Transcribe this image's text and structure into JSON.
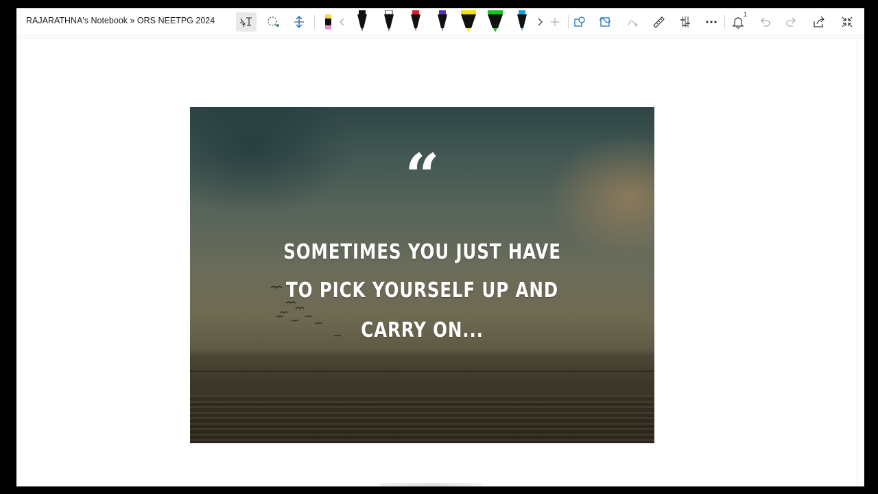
{
  "window": {
    "breadcrumb": "RAJARATHNA's Notebook » ORS NEETPG 2024"
  },
  "toolbar": {
    "tools": [
      {
        "icon": "text-select-icon"
      },
      {
        "icon": "lasso-select-icon"
      },
      {
        "icon": "insert-space-icon"
      },
      {
        "icon": "eraser-icon"
      }
    ],
    "pens": [
      {
        "icon": "pen-icon",
        "color": "#111111"
      },
      {
        "icon": "pen-icon",
        "color": "#111111"
      },
      {
        "icon": "pen-icon",
        "color": "#d9202a"
      },
      {
        "icon": "pen-icon",
        "color": "#5b2fbf"
      },
      {
        "icon": "highlighter-icon",
        "color": "#f5e400"
      },
      {
        "icon": "highlighter-icon",
        "color": "#16c41a"
      },
      {
        "icon": "pen-icon",
        "color": "#1aa0d8"
      }
    ],
    "notification_count": "1"
  },
  "quote": {
    "mark": "“",
    "line1": "SOMETIMES YOU JUST HAVE",
    "line2": "TO PICK YOURSELF UP AND",
    "line3": "CARRY ON..."
  }
}
